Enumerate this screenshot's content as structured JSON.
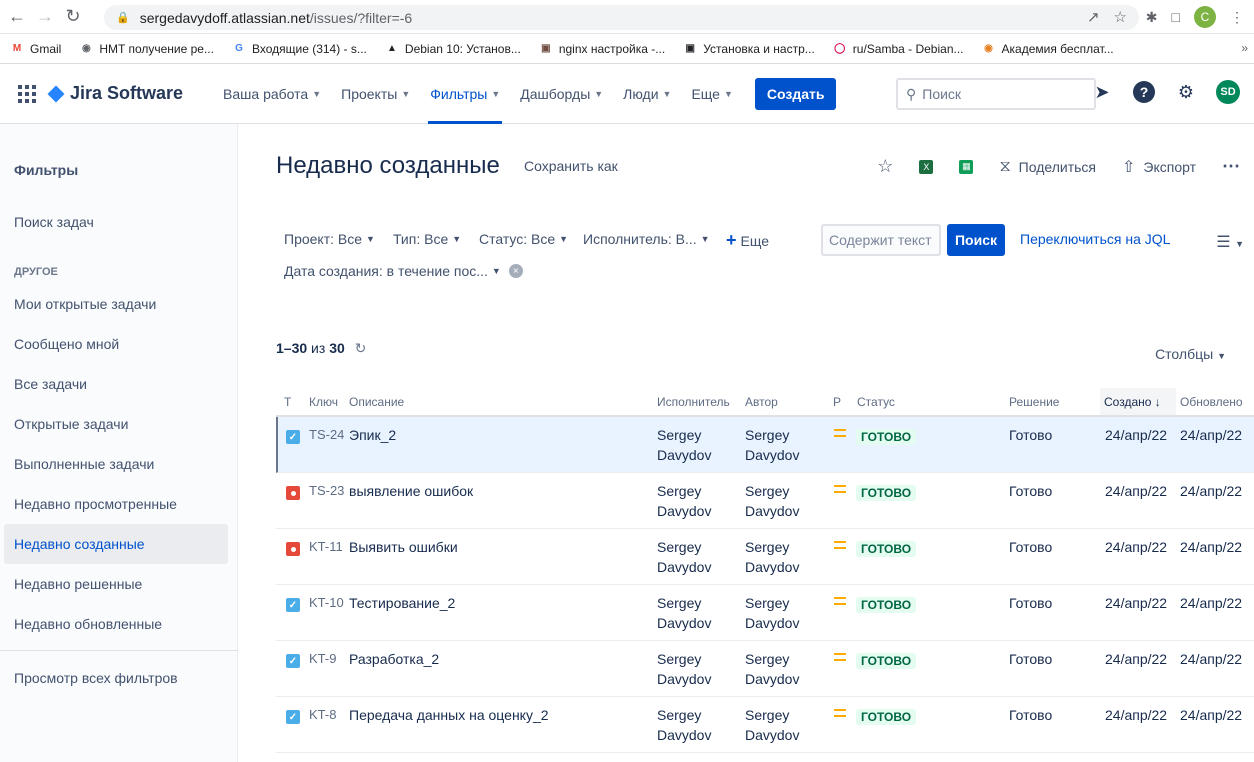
{
  "browser": {
    "url_host": "sergedavydoff.atlassian.net",
    "url_path": "/issues/?filter=-6",
    "profile_initial": "C",
    "bookmarks": [
      {
        "label": "Gmail",
        "icon": "gmail-icon"
      },
      {
        "label": "HMT получение ре...",
        "icon": "globe-icon"
      },
      {
        "label": "Входящие (314) - s...",
        "icon": "google-icon"
      },
      {
        "label": "Debian 10: Установ...",
        "icon": "linux-icon"
      },
      {
        "label": "nginx настройка -...",
        "icon": "image-icon"
      },
      {
        "label": "Установка и настр...",
        "icon": "site-icon"
      },
      {
        "label": "ru/Samba - Debian...",
        "icon": "debian-icon"
      },
      {
        "label": "Академия бесплат...",
        "icon": "academy-icon"
      }
    ]
  },
  "jira": {
    "product": "Jira Software",
    "nav": [
      {
        "label": "Ваша работа",
        "active": false
      },
      {
        "label": "Проекты",
        "active": false
      },
      {
        "label": "Фильтры",
        "active": true
      },
      {
        "label": "Дашборды",
        "active": false
      },
      {
        "label": "Люди",
        "active": false
      },
      {
        "label": "Еще",
        "active": false
      }
    ],
    "create_label": "Создать",
    "search_placeholder": "Поиск",
    "user_initials": "SD"
  },
  "sidebar": {
    "title": "Фильтры",
    "search_issues": "Поиск задач",
    "section_other": "ДРУГОЕ",
    "items": [
      "Мои открытые задачи",
      "Сообщено мной",
      "Все задачи",
      "Открытые задачи",
      "Выполненные задачи",
      "Недавно просмотренные",
      "Недавно созданные",
      "Недавно решенные",
      "Недавно обновленные"
    ],
    "selected_index": 6,
    "view_all": "Просмотр всех фильтров"
  },
  "page": {
    "title": "Недавно созданные",
    "save_as": "Сохранить как",
    "share": "Поделиться",
    "export": "Экспорт"
  },
  "filters": {
    "project": "Проект: Все",
    "type": "Тип: Все",
    "status": "Статус: Все",
    "assignee": "Исполнитель: В...",
    "more": "Еще",
    "text_placeholder": "Содержит текст",
    "search_button": "Поиск",
    "switch_jql": "Переключиться на JQL",
    "created": "Дата создания: в течение пос..."
  },
  "results": {
    "range": "1–30",
    "of": "из",
    "total": "30",
    "columns_button": "Столбцы"
  },
  "table": {
    "headers": {
      "type": "Т",
      "key": "Ключ",
      "summary": "Описание",
      "assignee": "Исполнитель",
      "reporter": "Автор",
      "priority": "Р",
      "status": "Статус",
      "resolution": "Решение",
      "created": "Создано",
      "updated": "Обновлено"
    },
    "rows": [
      {
        "type": "task",
        "key": "TS-24",
        "summary": "Эпик_2",
        "assignee_1": "Sergey",
        "assignee_2": "Davydov",
        "reporter_1": "Sergey",
        "reporter_2": "Davydov",
        "status": "ГОТОВО",
        "resolution": "Готово",
        "created": "24/апр/22",
        "updated": "24/апр/22"
      },
      {
        "type": "bug",
        "key": "TS-23",
        "summary": "выявление ошибок",
        "assignee_1": "Sergey",
        "assignee_2": "Davydov",
        "reporter_1": "Sergey",
        "reporter_2": "Davydov",
        "status": "ГОТОВО",
        "resolution": "Готово",
        "created": "24/апр/22",
        "updated": "24/апр/22"
      },
      {
        "type": "bug",
        "key": "KT-11",
        "summary": "Выявить ошибки",
        "assignee_1": "Sergey",
        "assignee_2": "Davydov",
        "reporter_1": "Sergey",
        "reporter_2": "Davydov",
        "status": "ГОТОВО",
        "resolution": "Готово",
        "created": "24/апр/22",
        "updated": "24/апр/22"
      },
      {
        "type": "task",
        "key": "KT-10",
        "summary": "Тестирование_2",
        "assignee_1": "Sergey",
        "assignee_2": "Davydov",
        "reporter_1": "Sergey",
        "reporter_2": "Davydov",
        "status": "ГОТОВО",
        "resolution": "Готово",
        "created": "24/апр/22",
        "updated": "24/апр/22"
      },
      {
        "type": "task",
        "key": "KT-9",
        "summary": "Разработка_2",
        "assignee_1": "Sergey",
        "assignee_2": "Davydov",
        "reporter_1": "Sergey",
        "reporter_2": "Davydov",
        "status": "ГОТОВО",
        "resolution": "Готово",
        "created": "24/апр/22",
        "updated": "24/апр/22"
      },
      {
        "type": "task",
        "key": "KT-8",
        "summary": "Передача данных на оценку_2",
        "assignee_1": "Sergey",
        "assignee_2": "Davydov",
        "reporter_1": "Sergey",
        "reporter_2": "Davydov",
        "status": "ГОТОВО",
        "resolution": "Готово",
        "created": "24/апр/22",
        "updated": "24/апр/22"
      }
    ],
    "selected_row": 0
  },
  "colors": {
    "brand": "#0052cc",
    "status_done_bg": "#e3fcef",
    "status_done_text": "#006644",
    "priority_medium": "#ffab00",
    "task_icon": "#4bade8",
    "bug_icon": "#e5493a"
  }
}
